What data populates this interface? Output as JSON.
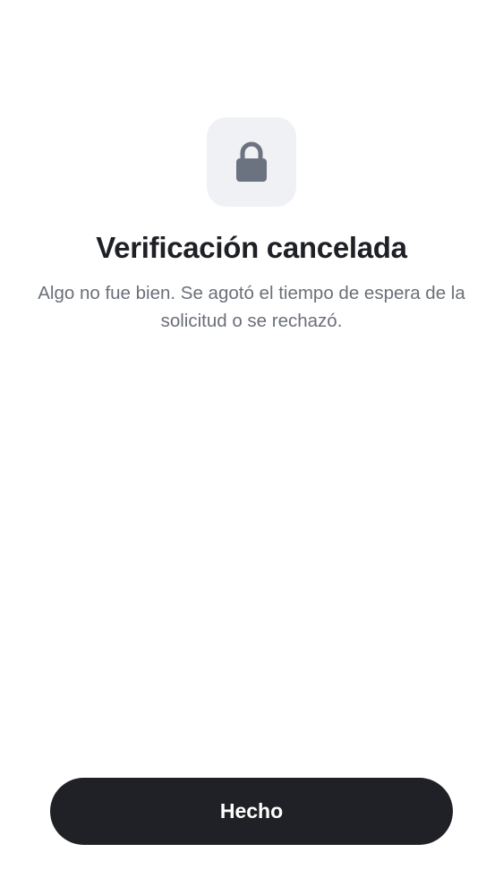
{
  "status": {
    "icon": "lock-icon",
    "title": "Verificación cancelada",
    "message": "Algo no fue bien. Se agotó el tiempo de espera de la solicitud o se rechazó."
  },
  "actions": {
    "done_label": "Hecho"
  },
  "colors": {
    "icon": "#6b7280",
    "icon_background": "#eff1f4",
    "title": "#1f2026",
    "message": "#6b6f78",
    "button_background": "#202126",
    "button_text": "#ffffff"
  }
}
